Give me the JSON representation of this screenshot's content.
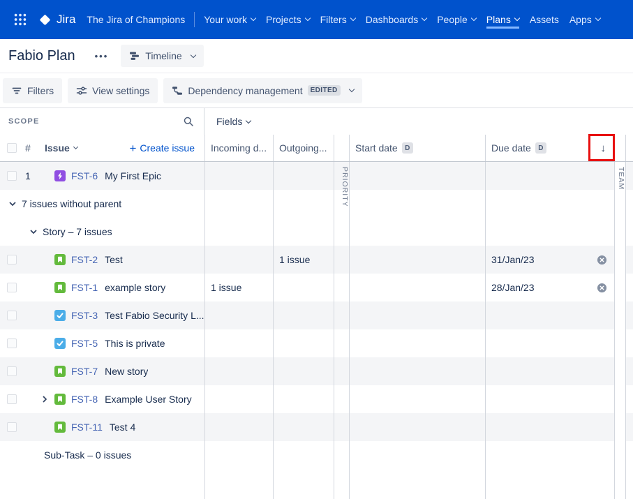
{
  "nav": {
    "brand": "Jira",
    "site": "The Jira of Champions",
    "items": [
      {
        "label": "Your work",
        "dropdown": true
      },
      {
        "label": "Projects",
        "dropdown": true
      },
      {
        "label": "Filters",
        "dropdown": true
      },
      {
        "label": "Dashboards",
        "dropdown": true
      },
      {
        "label": "People",
        "dropdown": true
      },
      {
        "label": "Plans",
        "dropdown": true,
        "active": true
      },
      {
        "label": "Assets",
        "dropdown": false
      },
      {
        "label": "Apps",
        "dropdown": true
      }
    ]
  },
  "plan": {
    "title": "Fabio Plan",
    "more": "•••",
    "view_mode": "Timeline"
  },
  "toolbar": {
    "filters": "Filters",
    "view_settings": "View settings",
    "dependency": "Dependency management",
    "dependency_badge": "EDITED"
  },
  "scope": {
    "heading": "SCOPE",
    "col_number": "#",
    "col_issue": "Issue",
    "create_plus": "+",
    "create_issue": "Create issue"
  },
  "fields": {
    "button": "Fields"
  },
  "columns": {
    "incoming": "Incoming d...",
    "outgoing": "Outgoing...",
    "start": "Start date",
    "due": "Due date",
    "date_badge": "D",
    "sort_arrow": "↓",
    "priority_collapsed": "PRIORITY",
    "team_collapsed": "TEAM"
  },
  "rows": [
    {
      "kind": "issue",
      "num": "1",
      "type": "epic",
      "key": "FST-6",
      "summary": "My First Epic"
    },
    {
      "kind": "group",
      "label": "7 issues without parent"
    },
    {
      "kind": "group",
      "label": "Story – 7 issues"
    },
    {
      "kind": "issue",
      "type": "story",
      "key": "FST-2",
      "summary": "Test",
      "outgoing": "1 issue",
      "due": "31/Jan/23"
    },
    {
      "kind": "issue",
      "type": "story",
      "key": "FST-1",
      "summary": "example story",
      "incoming": "1 issue",
      "due": "28/Jan/23"
    },
    {
      "kind": "issue",
      "type": "task",
      "key": "FST-3",
      "summary": "Test Fabio Security L..."
    },
    {
      "kind": "issue",
      "type": "task",
      "key": "FST-5",
      "summary": "This is private"
    },
    {
      "kind": "issue",
      "type": "story",
      "key": "FST-7",
      "summary": "New story"
    },
    {
      "kind": "issue",
      "type": "story",
      "key": "FST-8",
      "summary": "Example User Story",
      "expandable": true
    },
    {
      "kind": "issue",
      "type": "story",
      "key": "FST-11",
      "summary": "Test 4"
    },
    {
      "kind": "group",
      "label": "Sub-Task – 0 issues"
    }
  ],
  "colors": {
    "nav_bg": "#0052CC",
    "link_blue": "#0052CC",
    "epic_purple": "#904EE2",
    "story_green": "#63BA3C",
    "task_blue": "#4BADE8",
    "row_stripe": "#F4F5F7",
    "annotation_red": "#E81010"
  }
}
